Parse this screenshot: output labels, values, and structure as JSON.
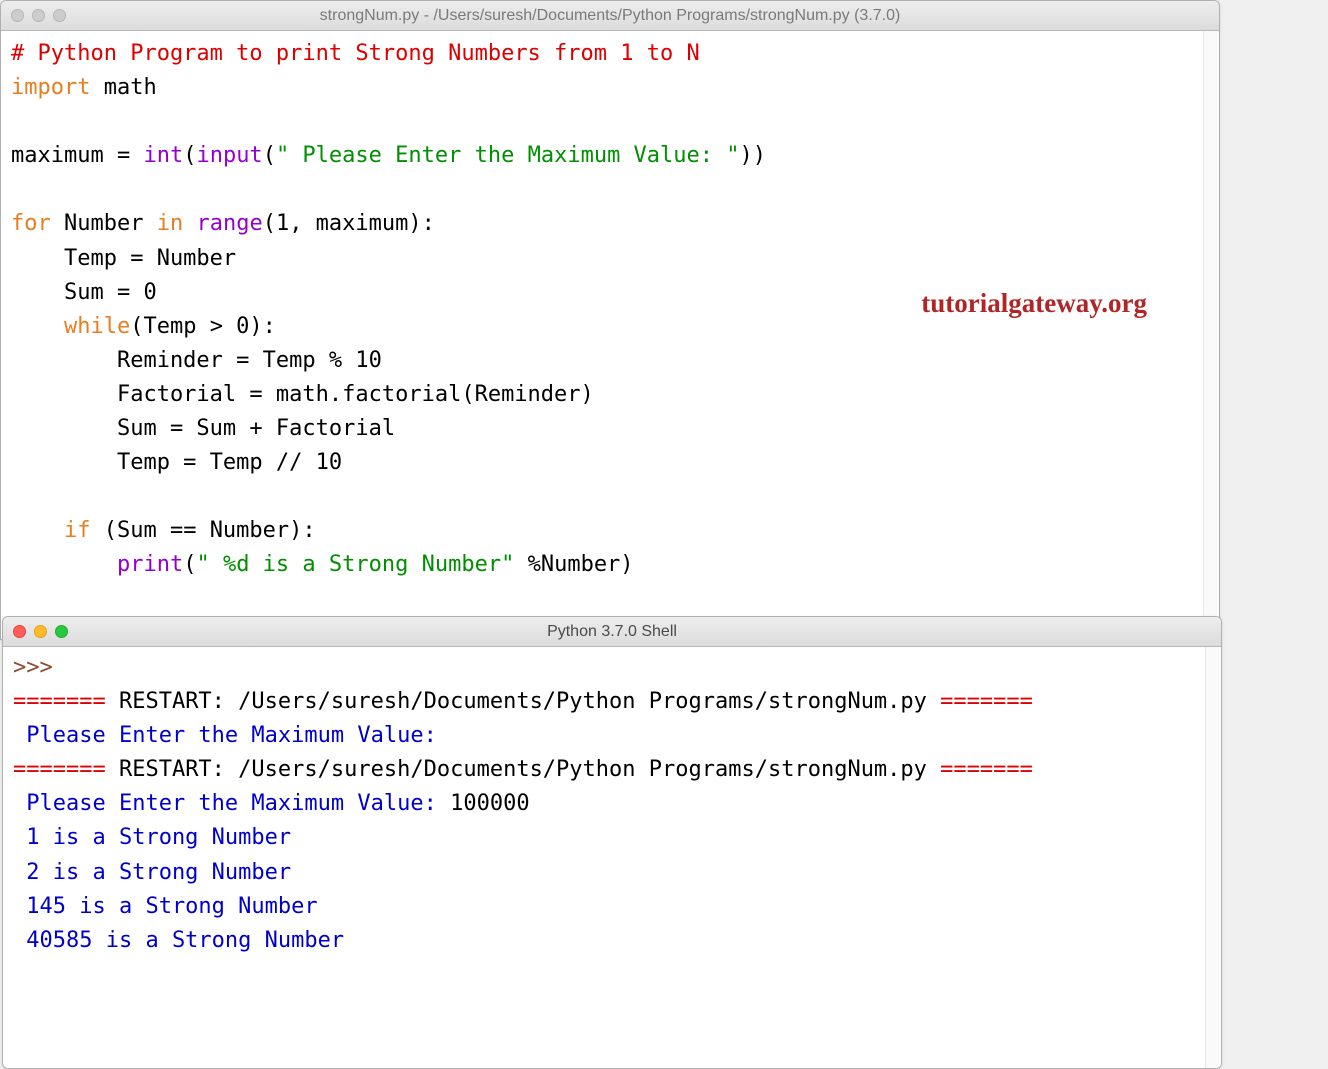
{
  "editor": {
    "title": "strongNum.py - /Users/suresh/Documents/Python Programs/strongNum.py (3.7.0)",
    "watermark": "tutorialgateway.org",
    "code": {
      "l1_comment": "# Python Program to print Strong Numbers from 1 to N",
      "l2_import": "import",
      "l2_math": " math",
      "l4_maximum": "maximum = ",
      "l4_int": "int",
      "l4_open": "(",
      "l4_input": "input",
      "l4_open2": "(",
      "l4_str": "\" Please Enter the Maximum Value: \"",
      "l4_close": "))",
      "l6_for": "for",
      "l6_number": " Number ",
      "l6_in": "in",
      "l6_sp": " ",
      "l6_range": "range",
      "l6_args": "(1, maximum):",
      "l7": "    Temp = Number",
      "l8": "    Sum = 0",
      "l9_ind": "    ",
      "l9_while": "while",
      "l9_rest": "(Temp > 0):",
      "l10": "        Reminder = Temp % 10",
      "l11": "        Factorial = math.factorial(Reminder)",
      "l12": "        Sum = Sum + Factorial",
      "l13": "        Temp = Temp // 10",
      "l15_ind": "    ",
      "l15_if": "if",
      "l15_rest": " (Sum == Number):",
      "l16_ind": "        ",
      "l16_print": "print",
      "l16_open": "(",
      "l16_str": "\" %d is a Strong Number\"",
      "l16_rest": " %Number)"
    }
  },
  "shell": {
    "title": "Python 3.7.0 Shell",
    "prompt": ">>> ",
    "restart1a": "=======",
    "restart1b": " RESTART: /Users/suresh/Documents/Python Programs/strongNum.py ",
    "restart1c": "=======",
    "line_prompt1": " Please Enter the Maximum Value: ",
    "restart2a": "=======",
    "restart2b": " RESTART: /Users/suresh/Documents/Python Programs/strongNum.py ",
    "restart2c": "=======",
    "line_prompt2": " Please Enter the Maximum Value: ",
    "input_val": "100000",
    "out1": " 1 is a Strong Number",
    "out2": " 2 is a Strong Number",
    "out3": " 145 is a Strong Number",
    "out4": " 40585 is a Strong Number"
  }
}
